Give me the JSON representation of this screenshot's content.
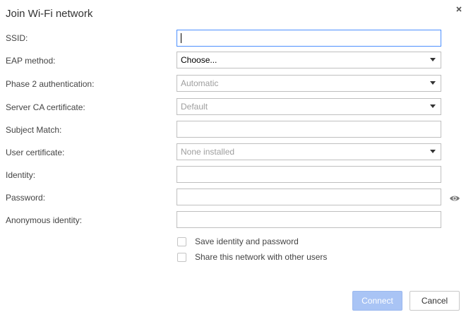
{
  "dialog": {
    "title": "Join Wi-Fi network"
  },
  "fields": {
    "ssid": {
      "label": "SSID:",
      "value": ""
    },
    "eap_method": {
      "label": "EAP method:",
      "value": "Choose..."
    },
    "phase2": {
      "label": "Phase 2 authentication:",
      "value": "Automatic"
    },
    "server_ca": {
      "label": "Server CA certificate:",
      "value": "Default"
    },
    "subject_match": {
      "label": "Subject Match:",
      "value": ""
    },
    "user_cert": {
      "label": "User certificate:",
      "value": "None installed"
    },
    "identity": {
      "label": "Identity:",
      "value": ""
    },
    "password": {
      "label": "Password:",
      "value": ""
    },
    "anonymous_identity": {
      "label": "Anonymous identity:",
      "value": ""
    }
  },
  "checkboxes": {
    "save_identity": {
      "label": "Save identity and password",
      "checked": false
    },
    "share_network": {
      "label": "Share this network with other users",
      "checked": false
    }
  },
  "buttons": {
    "connect": "Connect",
    "cancel": "Cancel"
  },
  "colors": {
    "focus_border": "#4d90fe",
    "connect_disabled_bg": "#a9c4f5",
    "disabled_text": "#9e9e9e"
  },
  "icons": {
    "close": "close-icon",
    "password_visibility": "eye-icon",
    "dropdown": "dropdown-arrow-icon"
  }
}
